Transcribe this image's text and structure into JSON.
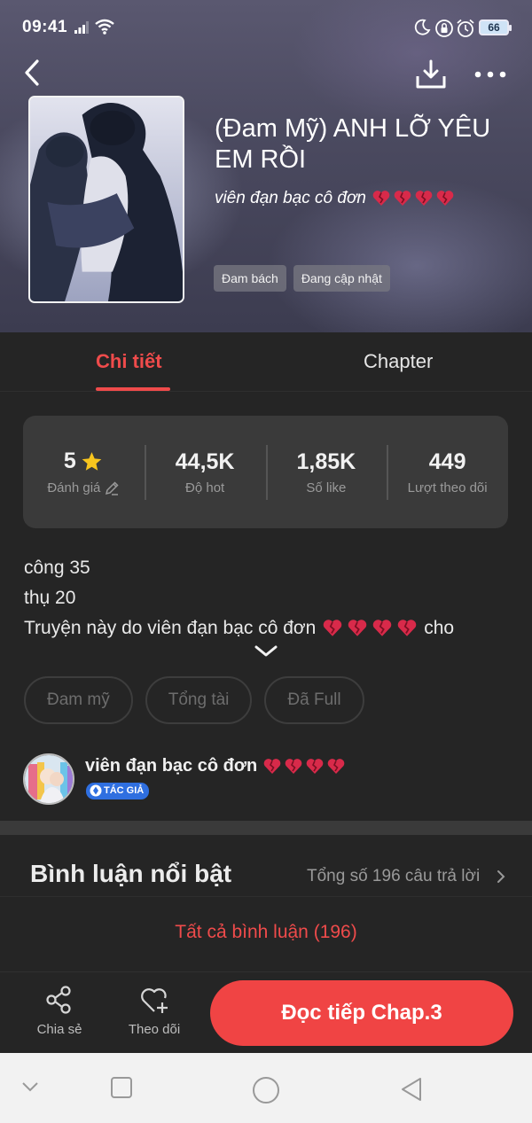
{
  "status_bar": {
    "time": "09:41",
    "battery": "66"
  },
  "book": {
    "title": "(Đam Mỹ) ANH LỠ YÊU EM RỒI",
    "author": "viên đạn bạc cô đơn",
    "tags": [
      "Đam bách",
      "Đang cập nhật"
    ]
  },
  "tabs": {
    "detail": "Chi tiết",
    "chapter": "Chapter"
  },
  "stats": [
    {
      "value": "5",
      "label": "Đánh giá"
    },
    {
      "value": "44,5K",
      "label": "Độ hot"
    },
    {
      "value": "1,85K",
      "label": "Số like"
    },
    {
      "value": "449",
      "label": "Lượt theo dõi"
    }
  ],
  "description": {
    "line1": "công 35",
    "line2": "thụ 20",
    "line3_prefix": "Truyện này do viên đạn bạc cô đơn",
    "line3_suffix": "cho"
  },
  "genres": [
    "Đam mỹ",
    "Tổng tài",
    "Đã Full"
  ],
  "author_card": {
    "name": "viên đạn bạc cô đơn",
    "badge": "TÁC GIẢ"
  },
  "comments": {
    "title": "Bình luận nổi bật",
    "count_text": "Tổng số 196 câu trả lời",
    "all_link": "Tất cả bình luận (196)"
  },
  "actions": {
    "share": "Chia sẻ",
    "follow": "Theo dõi",
    "read": "Đọc tiếp Chap.3"
  },
  "icons": [
    "signal-icon",
    "wifi-icon",
    "moon-icon",
    "rotation-lock-icon",
    "alarm-icon",
    "back-icon",
    "download-icon",
    "more-icon",
    "star-icon",
    "pencil-icon",
    "broken-heart-icon",
    "chevron-down-icon",
    "chevron-right-icon",
    "share-icon",
    "heart-plus-icon"
  ],
  "colors": {
    "accent": "#ef4b4b",
    "background": "#252525",
    "card": "#3a3a3a",
    "badge": "#2f6fe0"
  }
}
